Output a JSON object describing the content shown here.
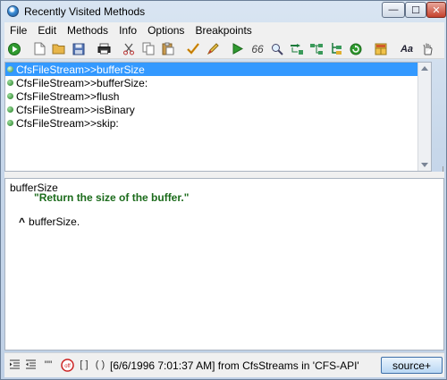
{
  "window": {
    "title": "Recently Visited Methods",
    "min_glyph": "—",
    "max_glyph": "☐",
    "close_glyph": "✕"
  },
  "menu": [
    {
      "label": "File"
    },
    {
      "label": "Edit"
    },
    {
      "label": "Methods"
    },
    {
      "label": "Info"
    },
    {
      "label": "Options"
    },
    {
      "label": "Breakpoints"
    }
  ],
  "toolbar": {
    "text_icon_aa": "Aa",
    "text_icon_66": "66"
  },
  "methods": [
    {
      "label": "CfsFileStream>>bufferSize",
      "selected": true
    },
    {
      "label": "CfsFileStream>>bufferSize:",
      "selected": false
    },
    {
      "label": "CfsFileStream>>flush",
      "selected": false
    },
    {
      "label": "CfsFileStream>>isBinary",
      "selected": false
    },
    {
      "label": "CfsFileStream>>skip:",
      "selected": false
    }
  ],
  "source": {
    "selector": "bufferSize",
    "comment": "\"Return the size of the buffer.\"",
    "return_caret": "^",
    "return_expr": "bufferSize."
  },
  "statusbar": {
    "info": "[6/6/1996 7:01:37 AM] from CfsStreams in 'CFS-API'",
    "icon_quote_label": "\"\"",
    "icon_brackets_label": "[ ]",
    "icon_parens_label": "( )",
    "source_button_label": "source+"
  },
  "colors": {
    "selection": "#3399ff",
    "comment": "#1b6b1b",
    "title_bg": "#c7d7ea"
  }
}
